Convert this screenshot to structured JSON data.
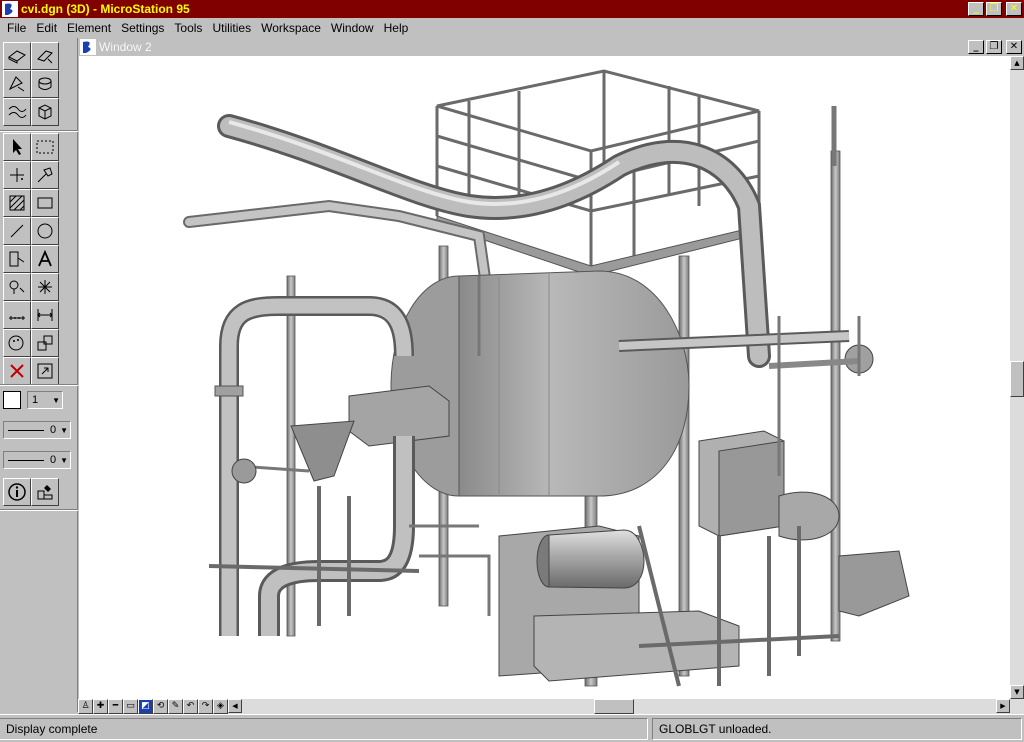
{
  "window": {
    "title": "cvi.dgn (3D) - MicroStation 95",
    "minimize": "_",
    "restore": "❐",
    "close": "✕"
  },
  "menu": [
    {
      "label": "File"
    },
    {
      "label": "Edit"
    },
    {
      "label": "Element"
    },
    {
      "label": "Settings"
    },
    {
      "label": "Tools"
    },
    {
      "label": "Utilities"
    },
    {
      "label": "Workspace"
    },
    {
      "label": "Window"
    },
    {
      "label": "Help"
    }
  ],
  "palette": {
    "active_level": "1",
    "line_style": "0",
    "line_weight": "0"
  },
  "view": {
    "title": "Window 2"
  },
  "status": {
    "left": "Display complete",
    "right": "GLOBLGT unloaded."
  }
}
